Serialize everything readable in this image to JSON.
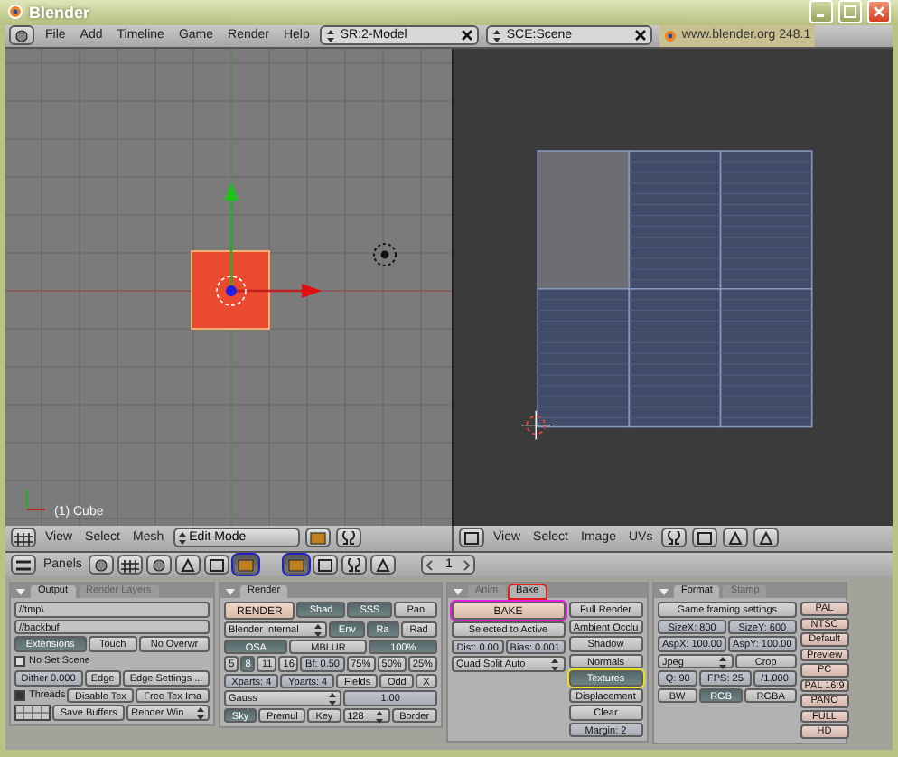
{
  "window": {
    "title": "Blender"
  },
  "menubar": {
    "menus": [
      "File",
      "Add",
      "Timeline",
      "Game",
      "Render",
      "Help"
    ],
    "screen": "SR:2-Model",
    "scene": "SCE:Scene",
    "version": "www.blender.org 248.1"
  },
  "view3d": {
    "object_label": "(1) Cube",
    "header": {
      "menus": [
        "View",
        "Select",
        "Mesh"
      ],
      "mode": "Edit Mode"
    }
  },
  "uv_editor": {
    "header": {
      "menus": [
        "View",
        "Select",
        "Image",
        "UVs"
      ]
    }
  },
  "buttons_window": {
    "header": {
      "label": "Panels",
      "frame": "1",
      "context_icons": [
        {
          "selected": false
        },
        {
          "selected": false
        },
        {
          "selected": false
        },
        {
          "selected": false
        },
        {
          "selected": false
        },
        {
          "selected": true,
          "highlighted": true
        }
      ],
      "sub_icons": [
        {
          "selected": true,
          "highlighted": true
        },
        {
          "selected": false
        },
        {
          "selected": false
        },
        {
          "selected": false
        }
      ]
    },
    "panels": [
      {
        "tabs": [
          {
            "label": "Output",
            "selected": true
          },
          {
            "label": "Render Layers",
            "selected": false
          }
        ],
        "columns": [
          {
            "rows": [
              {
                "controls": [
                  {
                    "kind": "path",
                    "label": "//tmp\\"
                  }
                ]
              },
              {
                "controls": [
                  {
                    "kind": "path",
                    "label": "//backbuf"
                  }
                ]
              },
              {
                "controls": [
                  {
                    "kind": "toggle",
                    "label": "Extensions",
                    "selected": true
                  },
                  {
                    "kind": "toggle",
                    "label": "Touch",
                    "selected": false
                  },
                  {
                    "kind": "toggle",
                    "label": "No Overwr",
                    "selected": false
                  }
                ]
              },
              {
                "controls": [
                  {
                    "kind": "checkbox",
                    "label": "No Set Scene",
                    "checked": false
                  }
                ]
              },
              {
                "controls": [
                  {
                    "kind": "field",
                    "label": "Dither 0.000"
                  },
                  {
                    "kind": "toggle",
                    "label": "Edge",
                    "selected": false
                  },
                  {
                    "kind": "button",
                    "label": "Edge Settings ..."
                  }
                ]
              },
              {
                "controls": [
                  {
                    "kind": "checkbox",
                    "label": "Threads",
                    "checked": true
                  },
                  {
                    "kind": "toggle",
                    "label": "Disable Tex",
                    "selected": false
                  },
                  {
                    "kind": "button",
                    "label": "Free Tex Ima"
                  }
                ]
              },
              {
                "controls": [
                  {
                    "kind": "layers"
                  },
                  {
                    "kind": "toggle",
                    "label": "Save Buffers",
                    "selected": false
                  },
                  {
                    "kind": "menu",
                    "label": "Render Win"
                  }
                ]
              }
            ]
          }
        ]
      },
      {
        "tabs": [
          {
            "label": "Render",
            "selected": true
          }
        ],
        "columns": [
          {
            "rows": [
              {
                "controls": [
                  {
                    "kind": "action",
                    "label": "RENDER"
                  },
                  {
                    "kind": "toggle",
                    "label": "Shad",
                    "selected": true
                  },
                  {
                    "kind": "toggle",
                    "label": "SSS",
                    "selected": true
                  },
                  {
                    "kind": "toggle",
                    "label": "Pan",
                    "selected": false
                  }
                ]
              },
              {
                "controls": [
                  {
                    "kind": "menu",
                    "label": "Blender Internal"
                  },
                  {
                    "kind": "toggle",
                    "label": "Env",
                    "selected": true
                  },
                  {
                    "kind": "toggle",
                    "label": "Ra",
                    "selected": true
                  },
                  {
                    "kind": "toggle",
                    "label": "Rad",
                    "selected": false
                  }
                ]
              },
              {
                "controls": [
                  {
                    "kind": "toggle",
                    "label": "OSA",
                    "selected": true
                  },
                  {
                    "kind": "toggle",
                    "label": "MBLUR",
                    "selected": false
                  },
                  {
                    "kind": "toggle",
                    "label": "100%",
                    "selected": true
                  }
                ]
              },
              {
                "controls": [
                  {
                    "kind": "toggle",
                    "label": "5",
                    "selected": false
                  },
                  {
                    "kind": "toggle",
                    "label": "8",
                    "selected": true
                  },
                  {
                    "kind": "toggle",
                    "label": "11",
                    "selected": false
                  },
                  {
                    "kind": "toggle",
                    "label": "16",
                    "selected": false
                  },
                  {
                    "kind": "field",
                    "label": "Bf: 0.50"
                  },
                  {
                    "kind": "toggle",
                    "label": "75%",
                    "selected": false
                  },
                  {
                    "kind": "toggle",
                    "label": "50%",
                    "selected": false
                  },
                  {
                    "kind": "toggle",
                    "label": "25%",
                    "selected": false
                  }
                ]
              },
              {
                "controls": [
                  {
                    "kind": "field",
                    "label": "Xparts: 4"
                  },
                  {
                    "kind": "field",
                    "label": "Yparts: 4"
                  },
                  {
                    "kind": "toggle",
                    "label": "Fields",
                    "selected": false
                  },
                  {
                    "kind": "toggle",
                    "label": "Odd",
                    "selected": false
                  },
                  {
                    "kind": "toggle",
                    "label": "X",
                    "selected": false
                  }
                ]
              },
              {
                "controls": [
                  {
                    "kind": "menu",
                    "label": "Gauss"
                  },
                  {
                    "kind": "field",
                    "label": "1.00"
                  }
                ]
              },
              {
                "controls": [
                  {
                    "kind": "toggle",
                    "label": "Sky",
                    "selected": true
                  },
                  {
                    "kind": "toggle",
                    "label": "Premul",
                    "selected": false
                  },
                  {
                    "kind": "toggle",
                    "label": "Key",
                    "selected": false
                  },
                  {
                    "kind": "menu",
                    "label": "128"
                  },
                  {
                    "kind": "toggle",
                    "label": "Border",
                    "selected": false
                  }
                ]
              }
            ]
          }
        ]
      },
      {
        "tabs": [
          {
            "label": "Anim",
            "selected": false
          },
          {
            "label": "Bake",
            "selected": true,
            "highlighted": true
          }
        ],
        "columns": [
          {
            "rows": [
              {
                "controls": [
                  {
                    "kind": "action",
                    "label": "BAKE",
                    "highlighted": true
                  }
                ]
              },
              {
                "controls": [
                  {
                    "kind": "toggle",
                    "label": "Selected to Active",
                    "selected": false
                  }
                ]
              },
              {
                "controls": [
                  {
                    "kind": "field",
                    "label": "Dist: 0.00"
                  },
                  {
                    "kind": "field",
                    "label": "Bias: 0.001"
                  }
                ]
              },
              {
                "controls": [
                  {
                    "kind": "menu",
                    "label": "Quad Split Auto"
                  }
                ]
              }
            ]
          },
          {
            "rows": [
              {
                "controls": [
                  {
                    "kind": "radio",
                    "label": "Full Render",
                    "selected": false
                  }
                ]
              },
              {
                "controls": [
                  {
                    "kind": "radio",
                    "label": "Ambient Occlu",
                    "selected": false
                  }
                ]
              },
              {
                "controls": [
                  {
                    "kind": "radio",
                    "label": "Shadow",
                    "selected": false
                  }
                ]
              },
              {
                "controls": [
                  {
                    "kind": "radio",
                    "label": "Normals",
                    "selected": false
                  }
                ]
              },
              {
                "controls": [
                  {
                    "kind": "radio",
                    "label": "Textures",
                    "selected": true,
                    "highlighted": true
                  }
                ]
              },
              {
                "controls": [
                  {
                    "kind": "radio",
                    "label": "Displacement",
                    "selected": false
                  }
                ]
              },
              {
                "controls": [
                  {
                    "kind": "button",
                    "label": "Clear"
                  }
                ]
              },
              {
                "controls": [
                  {
                    "kind": "field",
                    "label": "Margin: 2"
                  }
                ]
              }
            ]
          }
        ]
      },
      {
        "tabs": [
          {
            "label": "Format",
            "selected": true
          },
          {
            "label": "Stamp",
            "selected": false
          }
        ],
        "columns": [
          {
            "rows": [
              {
                "controls": [
                  {
                    "kind": "button",
                    "label": "Game framing settings"
                  }
                ]
              },
              {
                "controls": [
                  {
                    "kind": "field",
                    "label": "SizeX: 800"
                  },
                  {
                    "kind": "field",
                    "label": "SizeY: 600"
                  }
                ]
              },
              {
                "controls": [
                  {
                    "kind": "field",
                    "label": "AspX: 100.00"
                  },
                  {
                    "kind": "field",
                    "label": "AspY: 100.00"
                  }
                ]
              },
              {
                "controls": [
                  {
                    "kind": "menu",
                    "label": "Jpeg"
                  },
                  {
                    "kind": "toggle",
                    "label": "Crop",
                    "selected": false
                  }
                ]
              },
              {
                "controls": [
                  {
                    "kind": "field",
                    "label": "Q: 90"
                  },
                  {
                    "kind": "field",
                    "label": "FPS: 25"
                  },
                  {
                    "kind": "field",
                    "label": "/1.000"
                  }
                ]
              },
              {
                "controls": [
                  {
                    "kind": "toggle",
                    "label": "BW",
                    "selected": false
                  },
                  {
                    "kind": "toggle",
                    "label": "RGB",
                    "selected": true
                  },
                  {
                    "kind": "toggle",
                    "label": "RGBA",
                    "selected": false
                  }
                ]
              }
            ]
          },
          {
            "rows": [
              {
                "controls": [
                  {
                    "kind": "preset",
                    "label": "PAL"
                  }
                ]
              },
              {
                "controls": [
                  {
                    "kind": "preset",
                    "label": "NTSC"
                  }
                ]
              },
              {
                "controls": [
                  {
                    "kind": "preset",
                    "label": "Default"
                  }
                ]
              },
              {
                "controls": [
                  {
                    "kind": "preset",
                    "label": "Preview"
                  }
                ]
              },
              {
                "controls": [
                  {
                    "kind": "preset",
                    "label": "PC"
                  }
                ]
              },
              {
                "controls": [
                  {
                    "kind": "preset",
                    "label": "PAL 16:9"
                  }
                ]
              },
              {
                "controls": [
                  {
                    "kind": "preset",
                    "label": "PANO"
                  }
                ]
              },
              {
                "controls": [
                  {
                    "kind": "preset",
                    "label": "FULL"
                  }
                ]
              },
              {
                "controls": [
                  {
                    "kind": "preset",
                    "label": "HD"
                  }
                ]
              }
            ]
          }
        ]
      }
    ]
  }
}
